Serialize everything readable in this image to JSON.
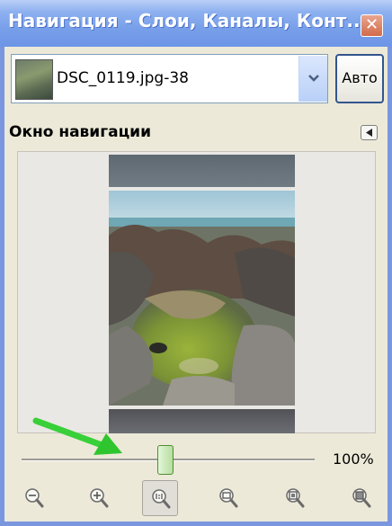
{
  "window": {
    "title": "Навигация - Слои, Каналы, Конт...",
    "close_glyph": "✕"
  },
  "image_selector": {
    "value": "DSC_0119.jpg-38",
    "auto_label": "Авто"
  },
  "section": {
    "title": "Окно навигации"
  },
  "zoom": {
    "value_text": "100%",
    "slider_level_fraction": 0.49,
    "buttons": [
      {
        "name": "zoom-out-icon"
      },
      {
        "name": "zoom-in-icon"
      },
      {
        "name": "zoom-1-1-icon"
      },
      {
        "name": "zoom-fit-width-icon"
      },
      {
        "name": "zoom-fit-image-icon"
      },
      {
        "name": "zoom-fill-window-icon"
      }
    ]
  },
  "colors": {
    "titlebar": "#789fe9",
    "window_bg": "#ece9d8",
    "slider_thumb": "#b6dd9f",
    "annotation_arrow": "#2fc52f"
  }
}
